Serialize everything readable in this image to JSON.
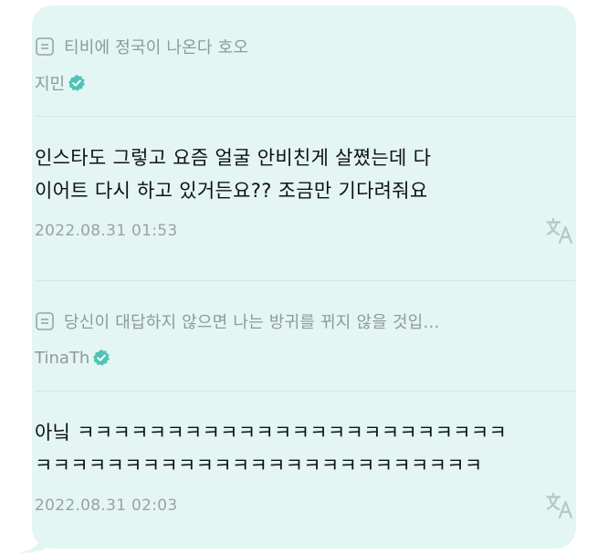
{
  "messages": [
    {
      "quote": "티비에 정국이 나온다 호오",
      "author": "지민",
      "text_lines": [
        "인스타도 그렇고 요즘 얼굴 안비친게 살쪘는데 다",
        "이어트 다시 하고 있거든요?? 조금만 기다려줘요"
      ],
      "timestamp": "2022.08.31 01:53"
    },
    {
      "quote": "당신이 대답하지 않으면 나는 방귀를 뀌지 않을 것입…",
      "author": "TinaTh",
      "text_lines": [
        "아닠 ㅋㅋㅋㅋㅋㅋㅋㅋㅋㅋㅋㅋㅋㅋㅋㅋㅋㅋㅋㅋㅋㅋㅋㅋ",
        "ㅋㅋㅋㅋㅋㅋㅋㅋㅋㅋㅋㅋㅋㅋㅋㅋㅋㅋㅋㅋㅋㅋㅋㅋㅋ"
      ],
      "timestamp": "2022.08.31 02:03"
    }
  ],
  "icons": {
    "quote": "quote-icon",
    "verified": "verified-badge-icon",
    "translate": "translate-icon"
  },
  "colors": {
    "bubble_background": "#e3f6f3",
    "verified_badge": "#4fc3b6",
    "translate_icon": "#b6c8c5"
  }
}
